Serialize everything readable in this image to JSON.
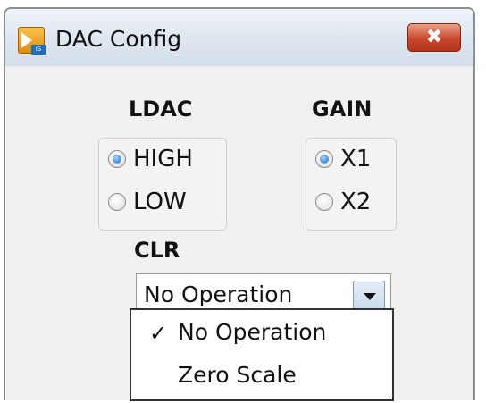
{
  "window": {
    "title": "DAC Config",
    "icon_tag": "IS",
    "close_glyph": "✖"
  },
  "ldac": {
    "label": "LDAC",
    "options": [
      {
        "label": "HIGH",
        "selected": true
      },
      {
        "label": "LOW",
        "selected": false
      }
    ]
  },
  "gain": {
    "label": "GAIN",
    "options": [
      {
        "label": "X1",
        "selected": true
      },
      {
        "label": "X2",
        "selected": false
      }
    ]
  },
  "clr": {
    "label": "CLR",
    "selected_value": "No Operation",
    "options": [
      {
        "label": "No Operation",
        "checked": true,
        "check_glyph": "✓"
      },
      {
        "label": "Zero Scale",
        "checked": false
      }
    ]
  },
  "icons": {
    "app": "labview-app-icon",
    "close": "close-icon",
    "dropdown": "chevron-down-icon",
    "check": "check-icon"
  },
  "colors": {
    "radio_selected": "#1c69c4",
    "close_button": "#c9472b",
    "window_bg": "#f0f0f0"
  }
}
